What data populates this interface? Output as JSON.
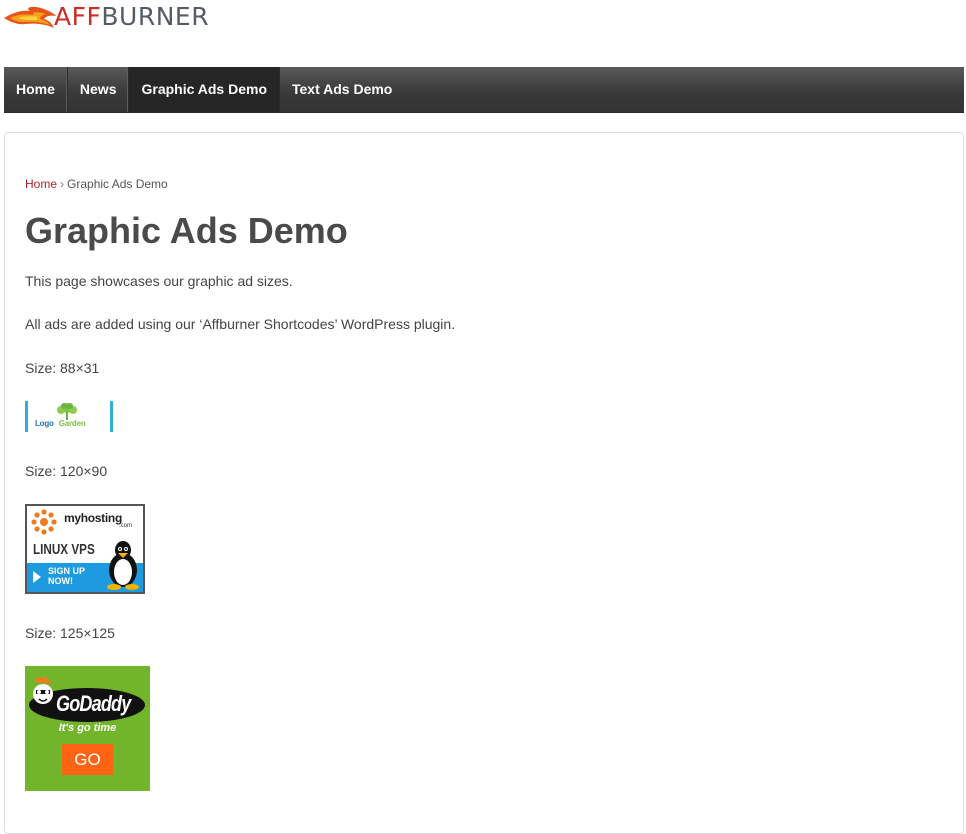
{
  "site": {
    "logo_aff": "AFF",
    "logo_burner": "BURNER"
  },
  "nav": {
    "items": [
      {
        "label": "Home"
      },
      {
        "label": "News"
      },
      {
        "label": "Graphic Ads Demo"
      },
      {
        "label": "Text Ads Demo"
      }
    ]
  },
  "breadcrumb": {
    "home": "Home",
    "separator": "›",
    "current": "Graphic Ads Demo"
  },
  "page": {
    "title": "Graphic Ads Demo",
    "intro": "This page showcases our graphic ad sizes.",
    "plugin_note": "All ads are added using our ‘Affburner Shortcodes’ WordPress plugin.",
    "size_88": "Size: 88×31",
    "size_120": "Size: 120×90",
    "size_125": "Size: 125×125"
  },
  "ads": {
    "logo_garden": {
      "brand_logo": "Logo",
      "brand_garden": "Garden"
    },
    "myhosting": {
      "brand": "myhosting",
      "brand_suffix": ".com",
      "product": "LINUX VPS",
      "cta_line1": "SIGN UP",
      "cta_line2": "NOW!"
    },
    "godaddy": {
      "brand": "GoDaddy",
      "tagline": "It's go time",
      "button": "GO"
    }
  },
  "colors": {
    "accent_red": "#b5202c",
    "nav_bg": "#3a3a3a",
    "godaddy_green": "#72b52b",
    "godaddy_orange": "#ff6314",
    "myhosting_blue": "#1e9be0"
  }
}
